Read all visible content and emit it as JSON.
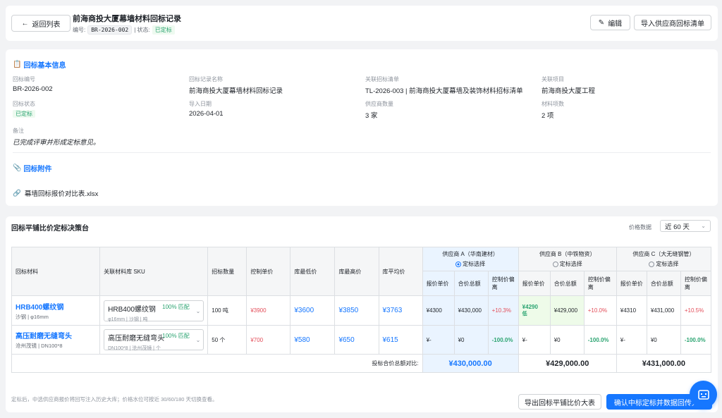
{
  "header": {
    "back_label": "返回列表",
    "title": "前海商投大厦幕墙材料回标记录",
    "code_label": "编号:",
    "code": "BR-2026-002",
    "status_label": "| 状态:",
    "status": "已定标",
    "edit_label": "编辑",
    "import_label": "导入供应商回标清单"
  },
  "info": {
    "basic_title": "回标基本信息",
    "fields": {
      "code": {
        "label": "回标编号",
        "value": "BR-2026-002"
      },
      "name": {
        "label": "回标记录名称",
        "value": "前海商投大厦幕墙材料回标记录"
      },
      "tender": {
        "label": "关联招标清单",
        "value": "TL-2026-003 | 前海商投大厦幕墙及装饰材料招标清单"
      },
      "project": {
        "label": "关联项目",
        "value": "前海商投大厦工程"
      },
      "status": {
        "label": "回标状态",
        "value": "已定标"
      },
      "date": {
        "label": "导入日期",
        "value": "2026-04-01"
      },
      "suppliers": {
        "label": "供应商数量",
        "value": "3 家"
      },
      "materials": {
        "label": "材料项数",
        "value": "2 项"
      }
    },
    "remark_label": "备注",
    "remark": "已完成评审并形成定标意见。",
    "attach_title": "回标附件",
    "attachment": "幕墙回标报价对比表.xlsx"
  },
  "comparison": {
    "title": "回标平铺比价定标决策台",
    "price_label": "价格数据",
    "price_range": "近 60 天",
    "headers": {
      "material": "回标材料",
      "sku": "关联材料库 SKU",
      "qty": "招标数量",
      "ctrl": "控制单价",
      "low": "库最低价",
      "high": "库最高价",
      "avg": "库平均价",
      "unit": "报价单价",
      "total": "合价总额",
      "dev": "控制价偏离",
      "pick": "定标选择"
    },
    "suppliers": [
      {
        "name": "供应商 A（华南建材）",
        "selected": true
      },
      {
        "name": "供应商 B（中铁物资）",
        "selected": false
      },
      {
        "name": "供应商 C（大无缝钢管）",
        "selected": false
      }
    ],
    "rows": [
      {
        "name": "HRB400螺纹钢",
        "spec": "沙钢 | φ16mm",
        "sku_name": "HRB400螺纹钢",
        "sku_match": "100% 匹配",
        "sku_spec": "φ16mm | 沙钢 | 吨",
        "qty": "100 吨",
        "ctrl": "¥3900",
        "low": "¥3600",
        "high": "¥3850",
        "avg": "¥3763",
        "quotes": [
          {
            "unit": "¥4300",
            "total": "¥430,000",
            "dev": "+10.3%"
          },
          {
            "unit": "¥4290",
            "unit_note": "低",
            "total": "¥429,000",
            "dev": "+10.0%"
          },
          {
            "unit": "¥4310",
            "total": "¥431,000",
            "dev": "+10.5%"
          }
        ]
      },
      {
        "name": "高压耐磨无缝弯头",
        "spec": "沧州茂镜 | DN100*8",
        "sku_name": "高压耐磨无缝弯头",
        "sku_match": "100% 匹配",
        "sku_spec": "DN100*8 | 沧州茂镜 | 个",
        "qty": "50 个",
        "ctrl": "¥700",
        "low": "¥580",
        "high": "¥650",
        "avg": "¥615",
        "quotes": [
          {
            "unit": "¥-",
            "total": "¥0",
            "dev": "-100.0%"
          },
          {
            "unit": "¥-",
            "total": "¥0",
            "dev": "-100.0%"
          },
          {
            "unit": "¥-",
            "total": "¥0",
            "dev": "-100.0%"
          }
        ]
      }
    ],
    "total_label": "投标合价总额对比:",
    "totals": [
      "¥430,000.00",
      "¥429,000.00",
      "¥431,000.00"
    ],
    "footer_note": "定标后，中选供应商报价将回写注入历史大库；价格水位可按近 30/60/180 天切换查看。",
    "export_label": "导出回标平铺比价大表",
    "confirm_label": "确认中标定标并数据回传大..."
  },
  "colors": {
    "primary": "#1677ff",
    "success": "#2ba471",
    "danger": "#e34d59"
  }
}
